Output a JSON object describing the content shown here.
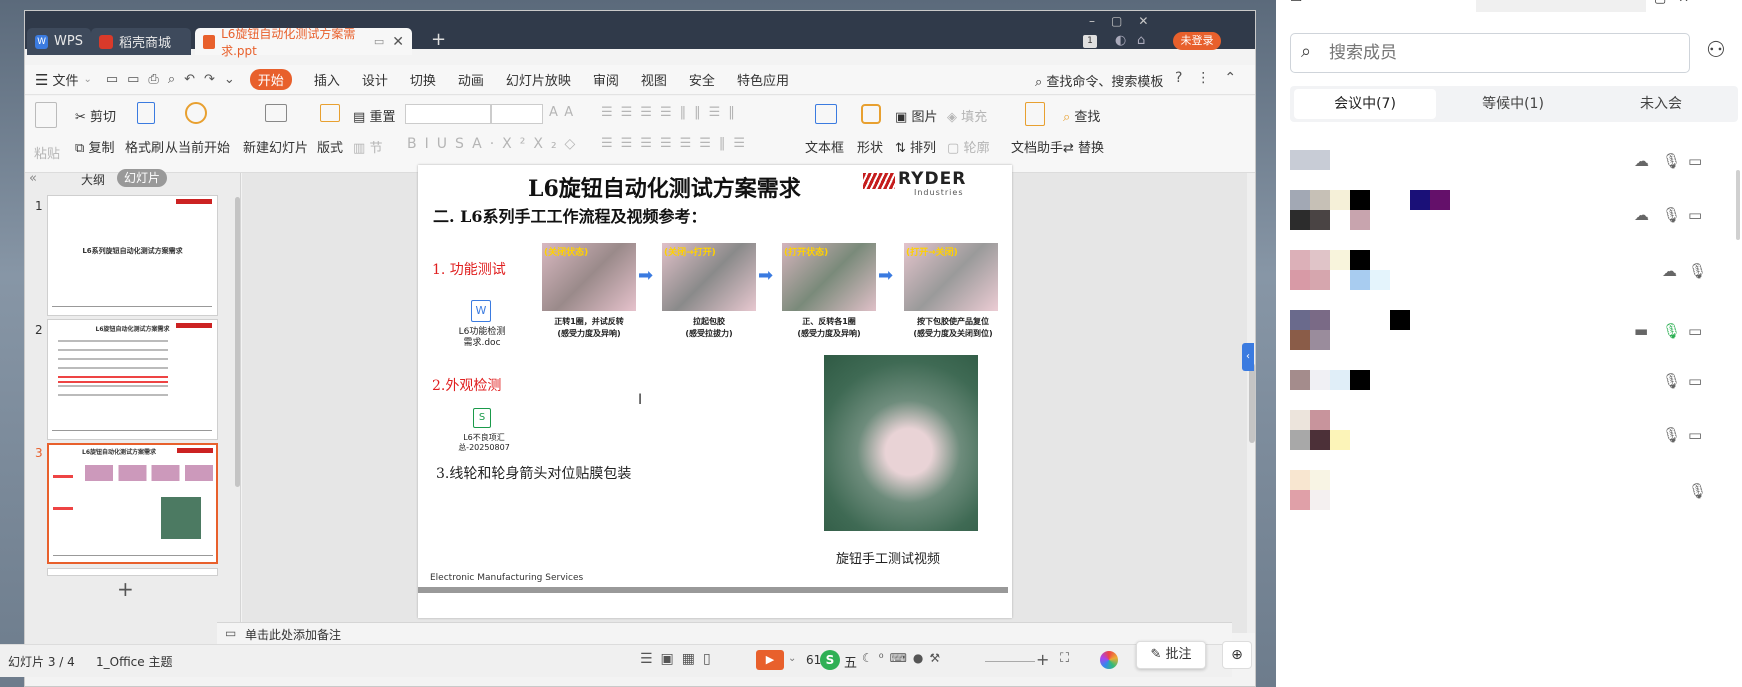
{
  "tabs": {
    "wps": "WPS",
    "store": "稻壳商城",
    "doc": "L6旋钮自动化测试方案需求.ppt",
    "login": "未登录",
    "page_count": "1"
  },
  "menu": [
    "文件",
    "开始",
    "插入",
    "设计",
    "切换",
    "动画",
    "幻灯片放映",
    "审阅",
    "视图",
    "安全",
    "特色应用"
  ],
  "search_cmd": "查找命令、搜索模板",
  "ribbon": {
    "paste": "粘贴",
    "cut": "剪切",
    "copy": "复制",
    "format_painter": "格式刷",
    "from_start": "从当前开始",
    "new_slide": "新建幻灯片",
    "layout": "版式",
    "reset": "重置",
    "section": "节",
    "picture": "图片",
    "fill": "填充",
    "textbox": "文本框",
    "shape": "形状",
    "arrange": "排列",
    "outline": "轮廓",
    "doc_helper": "文档助手",
    "find": "查找",
    "replace": "替换"
  },
  "panel_tabs": {
    "outline": "大纲",
    "slides": "幻灯片"
  },
  "thumbs": {
    "n1": "1",
    "n2": "2",
    "n3": "3",
    "t1": "L6系列旋钮自动化测试方案需求",
    "t2": "L6旋钮自动化测试方案需求",
    "t3": "L6旋钮自动化测试方案需求"
  },
  "slide": {
    "title": "L6旋钮自动化测试方案需求",
    "subtitle": "二. L6系列手工工作流程及视频参考：",
    "logo_main": "RYDER",
    "logo_sub": "Industries",
    "func_test": "1. 功能测试",
    "file1": "L6功能检测需求.doc",
    "visual_test": "2.外观检测",
    "file2": "L6不良项汇总-20250807",
    "item3": "3.线轮和轮身箭头对位贴膜包装",
    "steps": [
      {
        "tag": "(关闭状态)",
        "cap1": "正转1圈，并试反转",
        "cap2": "(感受力度及异响)"
      },
      {
        "tag": "(关闭→打开)",
        "cap1": "拉起包胶",
        "cap2": "(感受拉拔力)"
      },
      {
        "tag": "(打开状态)",
        "cap1": "正、反转各1圈",
        "cap2": "(感受力度及异响)"
      },
      {
        "tag": "(打开→关闭)",
        "cap1": "按下包胶使产品复位",
        "cap2": "(感受力度及关闭到位)"
      }
    ],
    "video_caption": "旋钮手工测试视频",
    "footer": "Electronic Manufacturing Services"
  },
  "notes_placeholder": "单击此处添加备注",
  "status": {
    "slide_info": "幻灯片 3 / 4",
    "theme": "1_Office 主题",
    "zoom": "61",
    "annotate": "批注",
    "ime": "五"
  },
  "meeting": {
    "search_placeholder": "搜索成员",
    "tabs": [
      "会议中(7)",
      "等候中(1)",
      "未入会"
    ]
  },
  "colors": {
    "accent": "#e8602c",
    "title_bar": "#303a4a",
    "red_text": "#e02020"
  }
}
